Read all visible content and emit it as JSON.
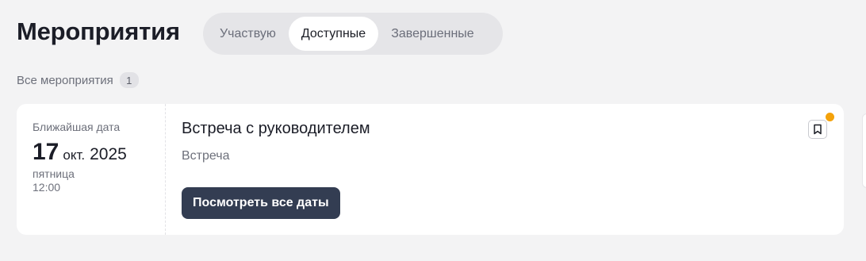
{
  "header": {
    "title": "Мероприятия"
  },
  "tabs": [
    {
      "label": "Участвую",
      "active": false
    },
    {
      "label": "Доступные",
      "active": true
    },
    {
      "label": "Завершенные",
      "active": false
    }
  ],
  "section": {
    "label": "Все мероприятия",
    "count": "1"
  },
  "event": {
    "date_caption": "Ближайшая дата",
    "day": "17",
    "month": "окт.",
    "year": "2025",
    "weekday": "пятница",
    "time": "12:00",
    "title": "Встреча с руководителем",
    "type": "Встреча",
    "button_label": "Посмотреть все даты",
    "bookmark_icon": "bookmark-icon"
  },
  "colors": {
    "background": "#f3f3f4",
    "button": "#333d52",
    "notification_dot": "#f4a20b"
  }
}
